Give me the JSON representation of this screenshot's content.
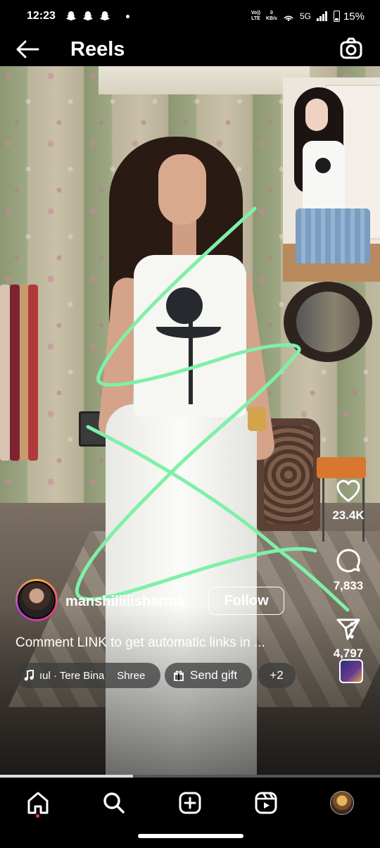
{
  "status_bar": {
    "time": "12:23",
    "network_top": "Vo))",
    "network_bottom": "LTE",
    "speed_top": "0",
    "speed_bottom": "KB/s",
    "signal": "5G",
    "battery": "15%"
  },
  "header": {
    "title": "Reels"
  },
  "reel": {
    "username": "manshiiiiiisharma_",
    "follow_label": "Follow",
    "caption": "Comment LINK to get automatic links in ...",
    "audio_left": "ıul · Tere Bina",
    "audio_right": "Shree",
    "gift_label": "Send gift",
    "more_chips_label": "+2",
    "likes": "23.4K",
    "comments": "7,833",
    "shares": "4,797",
    "progress": 0.35
  },
  "colors": {
    "scribble": "#7ef0a8",
    "live_dot": "#ff2d55"
  },
  "icons": {
    "back": "arrow-left-icon",
    "camera": "camera-icon",
    "like": "heart-icon",
    "comment": "comment-bubble-icon",
    "share": "paper-plane-icon",
    "more": "vertical-dots-icon",
    "music": "music-note-icon",
    "gift": "gift-icon",
    "nav": [
      "home-icon",
      "search-icon",
      "create-icon",
      "reels-icon",
      "profile-avatar"
    ]
  }
}
